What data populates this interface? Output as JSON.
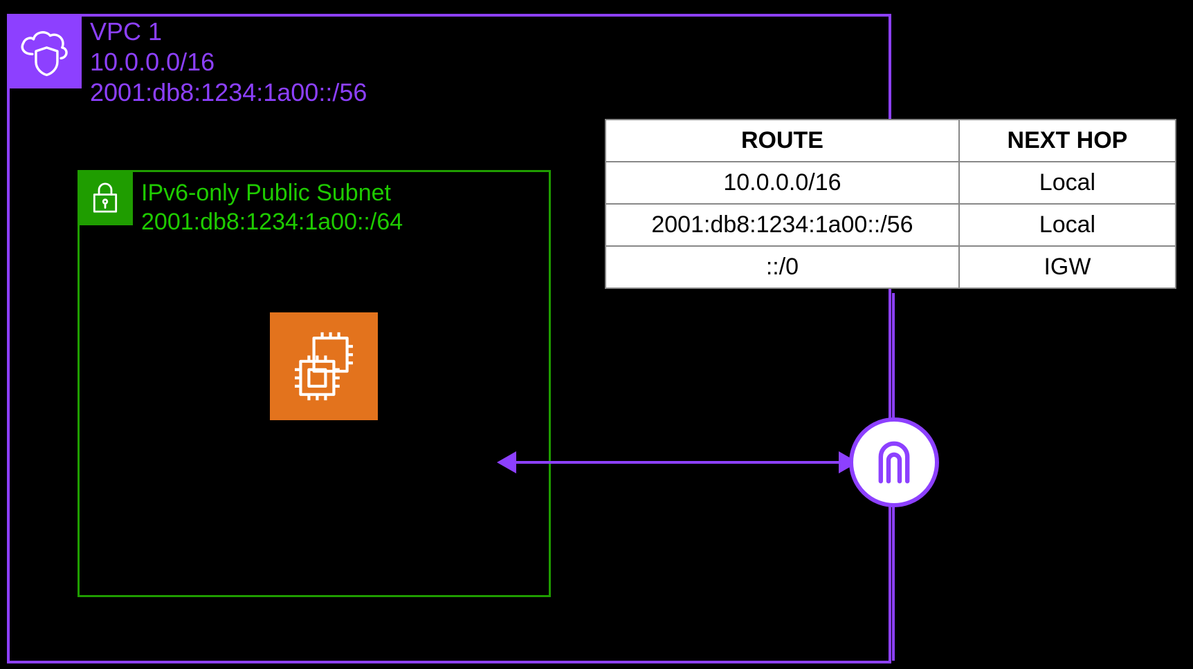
{
  "colors": {
    "vpc": "#8d40ff",
    "subnet_border": "#1f9d00",
    "subnet_text": "#1ecb00",
    "ec2": "#e3731d",
    "bg": "#000000"
  },
  "vpc": {
    "title": "VPC 1",
    "cidr_v4": "10.0.0.0/16",
    "cidr_v6": "2001:db8:1234:1a00::/56",
    "icon": "cloud-shield-icon"
  },
  "subnet": {
    "title": "IPv6-only Public Subnet",
    "cidr_v6": "2001:db8:1234:1a00::/64",
    "icon": "lock-icon"
  },
  "ec2": {
    "icon": "ec2-instance-icon"
  },
  "igw": {
    "icon": "internet-gateway-icon"
  },
  "route_table": {
    "headers": {
      "route": "ROUTE",
      "next_hop": "NEXT HOP"
    },
    "rows": [
      {
        "route": "10.0.0.0/16",
        "next_hop": "Local"
      },
      {
        "route": "2001:db8:1234:1a00::/56",
        "next_hop": "Local"
      },
      {
        "route": "::/0",
        "next_hop": "IGW"
      }
    ]
  }
}
